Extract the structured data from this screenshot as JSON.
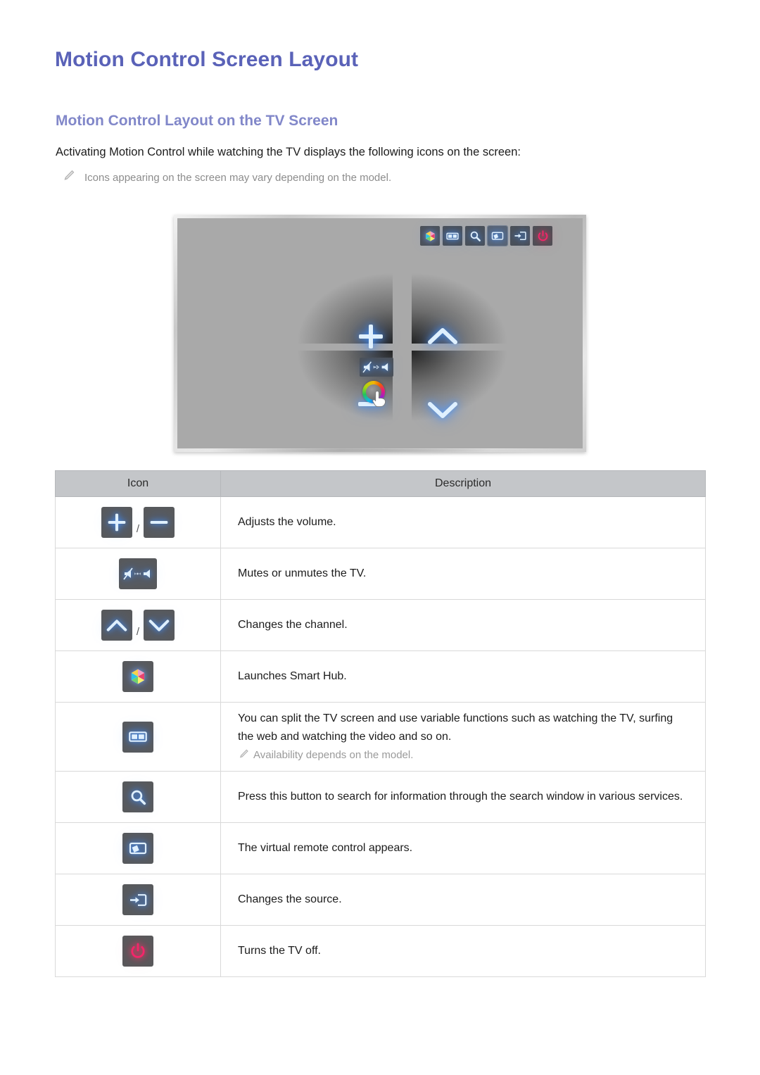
{
  "page": {
    "title": "Motion Control Screen Layout",
    "subtitle": "Motion Control Layout on the TV Screen",
    "intro": "Activating Motion Control while watching the TV displays the following icons on the screen:",
    "note": "Icons appearing on the screen may vary depending on the model."
  },
  "colors": {
    "title": "#5a62b8",
    "subtitle": "#8187c9",
    "table_header_bg": "#c4c6c9",
    "icon_tile_bg": "#58595b",
    "icon_glow_blue": "#4b9bff",
    "icon_glow_red": "#e6145a",
    "tv_screen_bg": "#a9a9a9"
  },
  "tv_illustration": {
    "name": "motion-control-tv-screen",
    "top_icon_bar": [
      "smart-hub-icon",
      "split-screen-icon",
      "search-icon",
      "virtual-remote-icon",
      "source-icon",
      "power-icon"
    ],
    "quadrant_glyphs": [
      "volume-up-plus-icon",
      "channel-up-chevron-icon",
      "volume-down-minus-icon",
      "channel-down-chevron-icon"
    ],
    "center_controls": [
      "mute-toggle-icon",
      "color-wheel-pointer-icon"
    ]
  },
  "table": {
    "headers": [
      "Icon",
      "Description"
    ],
    "rows": [
      {
        "icons": [
          "volume-up-plus-icon",
          "volume-down-minus-icon"
        ],
        "separator": "/",
        "description": "Adjusts the volume."
      },
      {
        "icons": [
          "mute-toggle-icon"
        ],
        "description": "Mutes or unmutes the TV."
      },
      {
        "icons": [
          "channel-up-chevron-icon",
          "channel-down-chevron-icon"
        ],
        "separator": "/",
        "description": "Changes the channel."
      },
      {
        "icons": [
          "smart-hub-icon"
        ],
        "description": "Launches Smart Hub."
      },
      {
        "icons": [
          "split-screen-icon"
        ],
        "description": "You can split the TV screen and use variable functions such as watching the TV, surfing the web and watching the video and so on.",
        "sub_note": "Availability depends on the model."
      },
      {
        "icons": [
          "search-icon"
        ],
        "description": "Press this button to search for information through the search window in various services."
      },
      {
        "icons": [
          "virtual-remote-icon"
        ],
        "description": "The virtual remote control appears."
      },
      {
        "icons": [
          "source-icon"
        ],
        "description": "Changes the source."
      },
      {
        "icons": [
          "power-icon"
        ],
        "description": "Turns the TV off."
      }
    ]
  }
}
